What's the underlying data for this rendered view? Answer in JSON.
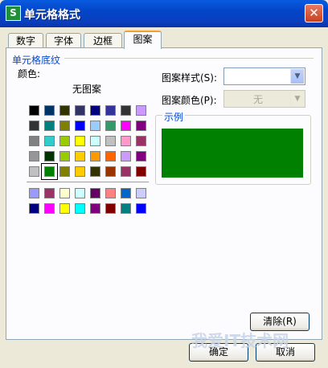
{
  "window": {
    "title": "单元格格式",
    "app_icon_text": "S",
    "close_glyph": "✕"
  },
  "tabs": [
    {
      "label": "数字"
    },
    {
      "label": "字体"
    },
    {
      "label": "边框"
    },
    {
      "label": "图案"
    }
  ],
  "active_tab": "图案",
  "shading": {
    "group_label": "单元格底纹",
    "color_label": "颜色:",
    "no_pattern_label": "无图案",
    "selected_color": "#008000",
    "main_palette": [
      [
        "#000000",
        "#003366",
        "#333300",
        "#333366",
        "#000080",
        "#333399",
        "#333333",
        "#cc99ff"
      ],
      [
        "#333333",
        "#008080",
        "#808000",
        "#0000ff",
        "#99ccff",
        "#339966",
        "#ff00ff",
        "#800080"
      ],
      [
        "#808080",
        "#33cccc",
        "#99cc00",
        "#ffff00",
        "#ccffff",
        "#c0c0c0",
        "#ff99cc",
        "#993366"
      ],
      [
        "#969696",
        "#003300",
        "#99cc00",
        "#ffcc00",
        "#ff9900",
        "#ff6600",
        "#cc99ff",
        "#800080"
      ],
      [
        "#c0c0c0",
        "#008000",
        "#808000",
        "#ffcc00",
        "#333300",
        "#993300",
        "#993366",
        "#800000"
      ]
    ],
    "extra_palette": [
      [
        "#9999ff",
        "#993366",
        "#ffffcc",
        "#ccffff",
        "#660066",
        "#ff8080",
        "#0066cc",
        "#ccccff"
      ],
      [
        "#000080",
        "#ff00ff",
        "#ffff00",
        "#00ffff",
        "#800080",
        "#800000",
        "#008080",
        "#0000ff"
      ]
    ]
  },
  "pattern": {
    "style_label": "图案样式(S):",
    "style_value": "",
    "color_label": "图案颜色(P):",
    "color_value": "无"
  },
  "sample": {
    "label": "示例",
    "fill_color": "#008000"
  },
  "buttons": {
    "clear": "清除(R)",
    "ok": "确定",
    "cancel": "取消"
  },
  "watermark": {
    "text": "我爱IT技术网"
  }
}
